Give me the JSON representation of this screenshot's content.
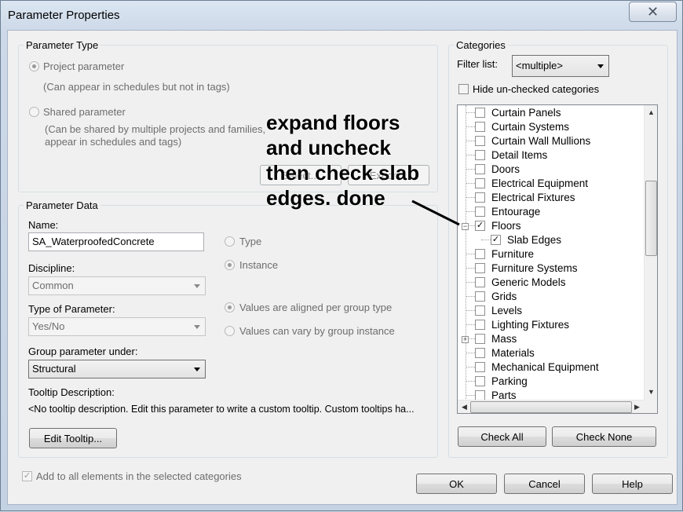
{
  "window": {
    "title": "Parameter Properties",
    "close_icon": "close-icon"
  },
  "parameter_type": {
    "group_label": "Parameter Type",
    "project_label": "Project parameter",
    "project_desc": "(Can appear in schedules but not in tags)",
    "shared_label": "Shared parameter",
    "shared_desc_line1": "(Can be shared by multiple projects and families,",
    "shared_desc_line2": "appear in schedules and tags)",
    "select_button": "Select...",
    "export_button": "Export..."
  },
  "parameter_data": {
    "group_label": "Parameter Data",
    "name_label": "Name:",
    "name_value": "SA_WaterproofedConcrete",
    "discipline_label": "Discipline:",
    "discipline_value": "Common",
    "type_label": "Type of Parameter:",
    "type_value": "Yes/No",
    "group_under_label": "Group parameter under:",
    "group_under_value": "Structural",
    "type_radio": "Type",
    "instance_radio": "Instance",
    "aligned_radio": "Values are aligned per group type",
    "vary_radio": "Values can vary by group instance",
    "tooltip_label": "Tooltip Description:",
    "tooltip_text": "<No tooltip description. Edit this parameter to write a custom tooltip. Custom tooltips ha...",
    "edit_tooltip_button": "Edit Tooltip..."
  },
  "add_to_all": "Add to all elements in the selected categories",
  "categories": {
    "group_label": "Categories",
    "filter_label": "Filter list:",
    "filter_value": "<multiple>",
    "hide_unchecked": "Hide un-checked categories",
    "items": [
      {
        "label": "Curtain Panels",
        "checked": false
      },
      {
        "label": "Curtain Systems",
        "checked": false
      },
      {
        "label": "Curtain Wall Mullions",
        "checked": false
      },
      {
        "label": "Detail Items",
        "checked": false
      },
      {
        "label": "Doors",
        "checked": false
      },
      {
        "label": "Electrical Equipment",
        "checked": false
      },
      {
        "label": "Electrical Fixtures",
        "checked": false
      },
      {
        "label": "Entourage",
        "checked": false
      },
      {
        "label": "Floors",
        "checked": true
      },
      {
        "label": "Slab Edges",
        "checked": true
      },
      {
        "label": "Furniture",
        "checked": false
      },
      {
        "label": "Furniture Systems",
        "checked": false
      },
      {
        "label": "Generic Models",
        "checked": false
      },
      {
        "label": "Grids",
        "checked": false
      },
      {
        "label": "Levels",
        "checked": false
      },
      {
        "label": "Lighting Fixtures",
        "checked": false
      },
      {
        "label": "Mass",
        "checked": false
      },
      {
        "label": "Materials",
        "checked": false
      },
      {
        "label": "Mechanical Equipment",
        "checked": false
      },
      {
        "label": "Parking",
        "checked": false
      },
      {
        "label": "Parts",
        "checked": false
      }
    ],
    "check_all": "Check All",
    "check_none": "Check None"
  },
  "footer": {
    "ok": "OK",
    "cancel": "Cancel",
    "help": "Help"
  },
  "annotation": {
    "line1": "expand floors",
    "line2": "and uncheck",
    "line3": "then check slab",
    "line4": "edges. done"
  }
}
